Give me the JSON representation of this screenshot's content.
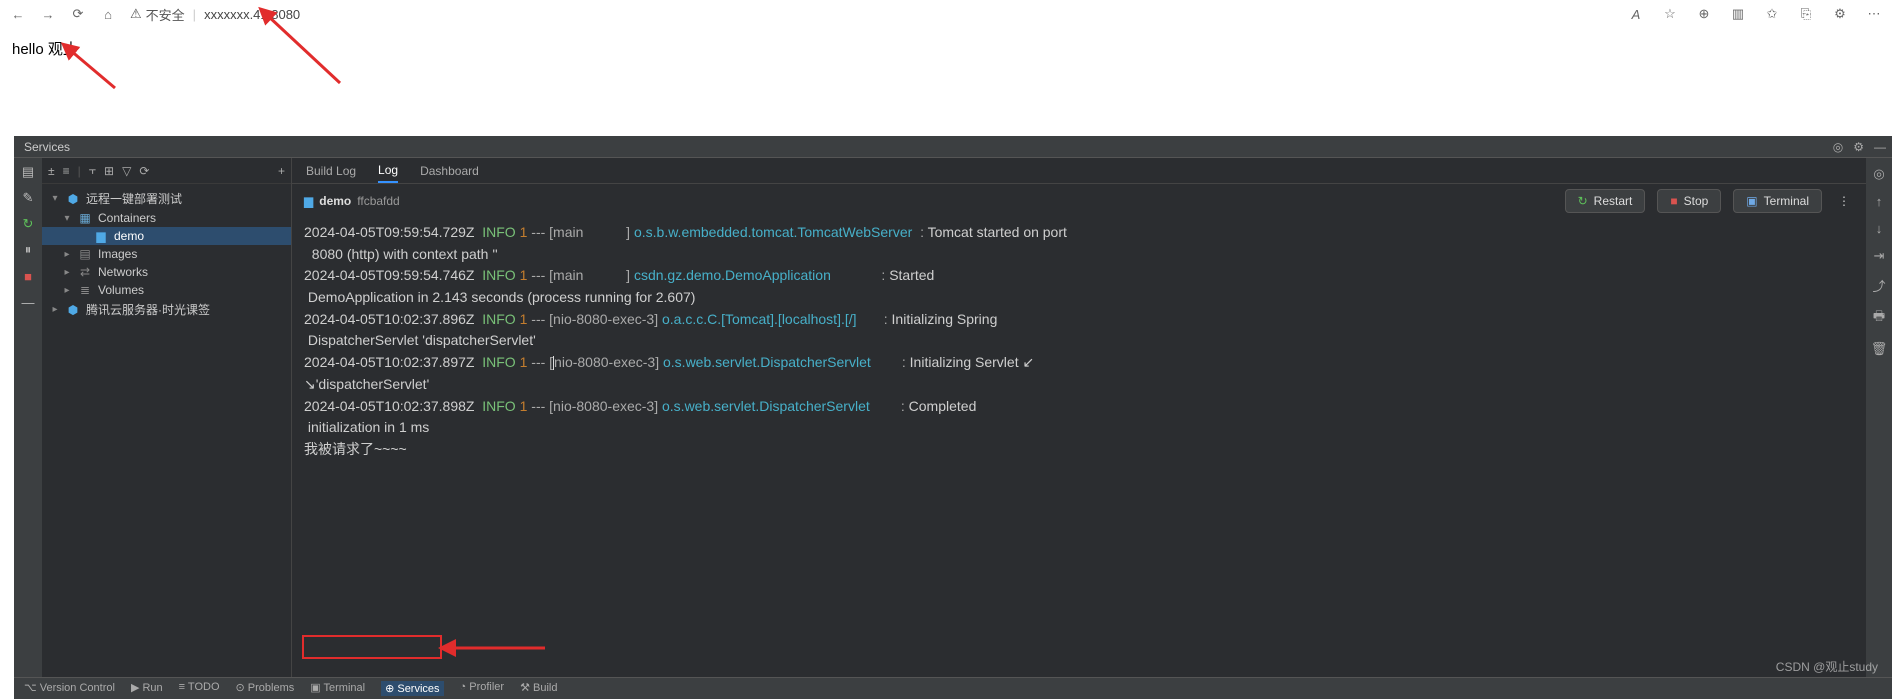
{
  "browser": {
    "nav": {
      "back": "←",
      "forward": "→",
      "reload": "⟳",
      "home": "⌂"
    },
    "security_label": "不安全",
    "address": "xxxxxxx.41:8080",
    "right_icons": [
      "A",
      "☆",
      "⊕",
      "▥",
      "✩",
      "⎘",
      "⚙",
      "⋯"
    ]
  },
  "page": {
    "body_text": "hello 观止"
  },
  "ide": {
    "title": "Services",
    "win_icons": [
      "◎",
      "⚙",
      "—"
    ],
    "gutter_left": [
      "▤",
      "✎",
      "↻",
      "⏸",
      "■",
      "—"
    ],
    "services_tb": [
      "±",
      "≡",
      "⫟",
      "⊞",
      "▽",
      "⟳",
      "+"
    ],
    "tree": {
      "root": "远程一键部署测试",
      "containers_label": "Containers",
      "demo_label": "demo",
      "images_label": "Images",
      "networks_label": "Networks",
      "volumes_label": "Volumes",
      "other_server": "腾讯云服务器·时光课签"
    },
    "tabs": {
      "build": "Build Log",
      "log": "Log",
      "dash": "Dashboard"
    },
    "crumb": {
      "name": "demo",
      "hash": "ffcbafdd"
    },
    "actions": {
      "restart": "Restart",
      "stop": "Stop",
      "terminal": "Terminal",
      "more": "⋮"
    },
    "right_gutter": [
      "◎",
      "↑",
      "↓",
      "⇥",
      "⤴",
      "🖶",
      "🗑"
    ],
    "log_lines": [
      {
        "ts": "2024-04-05T09:59:54.729Z",
        "lvl": "INFO",
        "pid": "1",
        "thr": "main",
        "logger": "o.s.b.w.embedded.tomcat.TomcatWebServer",
        "msg": "Tomcat started on port"
      },
      {
        "cont": "  8080 (http) with context path ''"
      },
      {
        "ts": "2024-04-05T09:59:54.746Z",
        "lvl": "INFO",
        "pid": "1",
        "thr": "main",
        "logger": "csdn.gz.demo.DemoApplication",
        "msg": "Started"
      },
      {
        "cont": " DemoApplication in 2.143 seconds (process running for 2.607)"
      },
      {
        "ts": "2024-04-05T10:02:37.896Z",
        "lvl": "INFO",
        "pid": "1",
        "thr": "nio-8080-exec-3",
        "logger": "o.a.c.c.C.[Tomcat].[localhost].[/]",
        "msg": "Initializing Spring"
      },
      {
        "cont": " DispatcherServlet 'dispatcherServlet'"
      },
      {
        "ts": "2024-04-05T10:02:37.897Z",
        "lvl": "INFO",
        "pid": "1",
        "thr": "nio-8080-exec-3",
        "logger": "o.s.web.servlet.DispatcherServlet",
        "msg": "Initializing Servlet ↙"
      },
      {
        "cont": "↘'dispatcherServlet'"
      },
      {
        "ts": "2024-04-05T10:02:37.898Z",
        "lvl": "INFO",
        "pid": "1",
        "thr": "nio-8080-exec-3",
        "logger": "o.s.web.servlet.DispatcherServlet",
        "msg": "Completed"
      },
      {
        "cont": " initialization in 1 ms"
      },
      {
        "plain": "我被请求了~~~~"
      }
    ],
    "status": {
      "left_items": [
        "Version Control",
        "Run",
        "TODO",
        "Problems",
        "Terminal",
        "Services",
        "Profiler",
        "Build"
      ],
      "prefixes": [
        "⌥",
        "▶",
        "≡",
        "⊙",
        "▣",
        "⊕",
        "◔",
        "⚒"
      ]
    }
  },
  "watermark": "CSDN @观止study"
}
